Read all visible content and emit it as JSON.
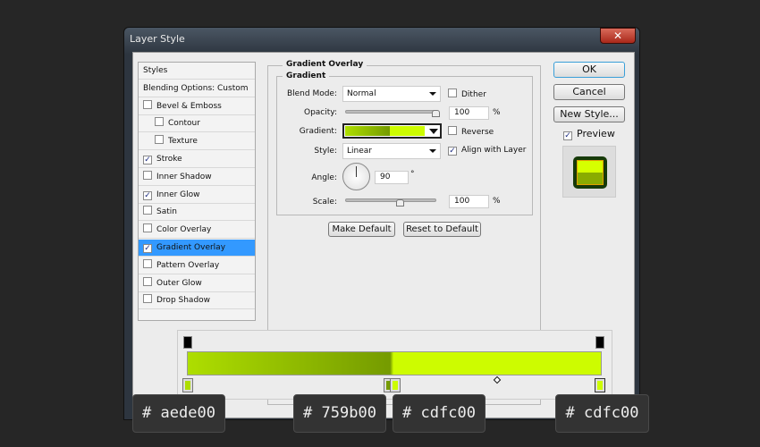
{
  "window": {
    "title": "Layer Style",
    "close": "✕"
  },
  "sidebar": {
    "items": [
      {
        "label": "Styles",
        "checkbox": false
      },
      {
        "label": "Blending Options: Custom",
        "checkbox": false
      },
      {
        "label": "Bevel & Emboss",
        "checkbox": true,
        "checked": false
      },
      {
        "label": "Contour",
        "checkbox": true,
        "checked": false,
        "indent": true
      },
      {
        "label": "Texture",
        "checkbox": true,
        "checked": false,
        "indent": true
      },
      {
        "label": "Stroke",
        "checkbox": true,
        "checked": true
      },
      {
        "label": "Inner Shadow",
        "checkbox": true,
        "checked": false
      },
      {
        "label": "Inner Glow",
        "checkbox": true,
        "checked": true
      },
      {
        "label": "Satin",
        "checkbox": true,
        "checked": false
      },
      {
        "label": "Color Overlay",
        "checkbox": true,
        "checked": false
      },
      {
        "label": "Gradient Overlay",
        "checkbox": true,
        "checked": true,
        "selected": true
      },
      {
        "label": "Pattern Overlay",
        "checkbox": true,
        "checked": false
      },
      {
        "label": "Outer Glow",
        "checkbox": true,
        "checked": false
      },
      {
        "label": "Drop Shadow",
        "checkbox": true,
        "checked": false
      }
    ]
  },
  "panel": {
    "title": "Gradient Overlay",
    "group": "Gradient",
    "blend_mode_label": "Blend Mode:",
    "blend_mode": "Normal",
    "dither": "Dither",
    "opacity_label": "Opacity:",
    "opacity": "100",
    "opacity_unit": "%",
    "opacity_fraction": 1.0,
    "gradient_label": "Gradient:",
    "reverse": "Reverse",
    "style_label": "Style:",
    "style": "Linear",
    "align": "Align with Layer",
    "angle_label": "Angle:",
    "angle": "90",
    "angle_unit": "°",
    "scale_label": "Scale:",
    "scale": "100",
    "scale_unit": "%",
    "scale_fraction": 0.5,
    "make_default": "Make Default",
    "reset_default": "Reset to Default"
  },
  "buttons": {
    "ok": "OK",
    "cancel": "Cancel",
    "new_style": "New Style...",
    "preview": "Preview"
  },
  "colors": {
    "c1": "#aede00",
    "c2": "#759b00",
    "c3": "#cdfc00",
    "select": "#3399ff"
  },
  "tags": [
    "# aede00",
    "# 759b00",
    "# cdfc00",
    "# cdfc00"
  ]
}
